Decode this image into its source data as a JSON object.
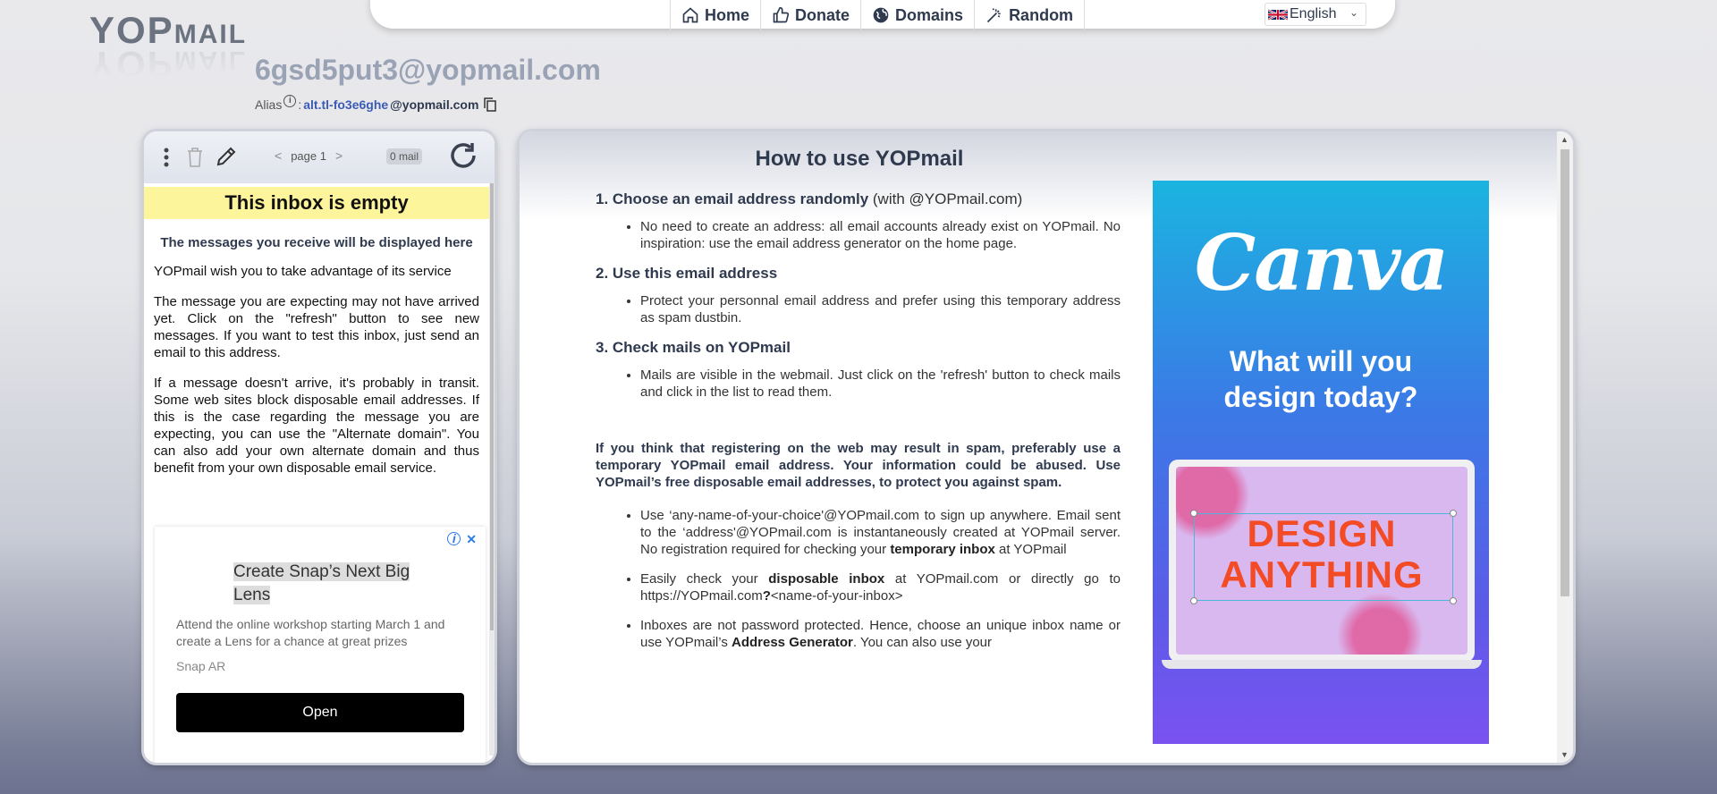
{
  "logo": {
    "text_a": "YOP",
    "text_b": "MAIL"
  },
  "nav": {
    "items": [
      {
        "label": "Home",
        "icon": "home-icon"
      },
      {
        "label": "Donate",
        "icon": "thumbs-up-icon"
      },
      {
        "label": "Domains",
        "icon": "globe-icon"
      },
      {
        "label": "Random",
        "icon": "magic-wand-icon"
      }
    ],
    "language": "English"
  },
  "address": {
    "email": "6gsd5put3@yopmail.com",
    "alias_label": "Alias",
    "alias_sep": ":",
    "alias_name": "alt.tl-fo3e6ghe",
    "alias_domain": "@yopmail.com"
  },
  "inbox": {
    "page": "page 1",
    "mail_count": "0 mail",
    "empty_title": "This inbox is empty",
    "lead": "The messages you receive will be displayed here",
    "p1": "YOPmail wish you to take advantage of its service",
    "p2": "The message you are expecting may not have arrived yet. Click on the \"refresh\" button to see new messages. If you want to test this inbox, just send an email to this address.",
    "p3": "If a message doesn't arrive, it's probably in transit. Some web sites block disposable email addresses. If this is the case regarding the message you are expecting, you can use the \"Alternate domain\". You can also add your own alternate domain and thus benefit from your own disposable email service."
  },
  "ad_left": {
    "title": "Create Snap’s Next Big Lens",
    "desc": "Attend the online workshop starting March 1 and create a Lens for a chance at great prizes",
    "brand": "Snap AR",
    "button": "Open"
  },
  "howto": {
    "title": "How to use YOPmail",
    "s1_title": "1. Choose an email address randomly",
    "s1_suffix": " (with @YOPmail.com)",
    "s1_item": "No need to create an address: all email accounts already exist on YOPmail. No inspiration: use the email address generator on the home page.",
    "s2_title": "2. Use this email address",
    "s2_item": "Protect your personnal email address and prefer using this temporary address as spam dustbin.",
    "s3_title": "3. Check mails on YOPmail",
    "s3_item": "Mails are visible in the webmail. Just click on the 'refresh' button to check mails and click in the list to read them.",
    "warning": "If you think that registering on the web may result in spam, preferably use a temporary YOPmail email address. Your information could be abused. Use YOPmail’s free disposable email addresses, to protect you against spam.",
    "b1_a": "Use ‘any-name-of-your-choice'@YOPmail.com to sign up anywhere. Email sent to the ‘address'@YOPmail.com is instantaneously created at YOPmail server. No registration required for checking your ",
    "b1_b": "temporary inbox",
    "b1_c": " at YOPmail",
    "b2_a": "Easily check your ",
    "b2_b": "disposable inbox",
    "b2_c": " at YOPmail.com or directly go to https://YOPmail.com",
    "b2_d": "?",
    "b2_e": "<name-of-your-inbox>",
    "b3_a": "Inboxes are not password protected. Hence, choose an unique inbox name or use YOPmail’s ",
    "b3_b": "Address Generator",
    "b3_c": ". You can also use your"
  },
  "ad_right": {
    "logo": "Canva",
    "tagline_1": "What will you",
    "tagline_2": "design today?",
    "screen_1": "DESIGN",
    "screen_2": "ANYTHING"
  }
}
